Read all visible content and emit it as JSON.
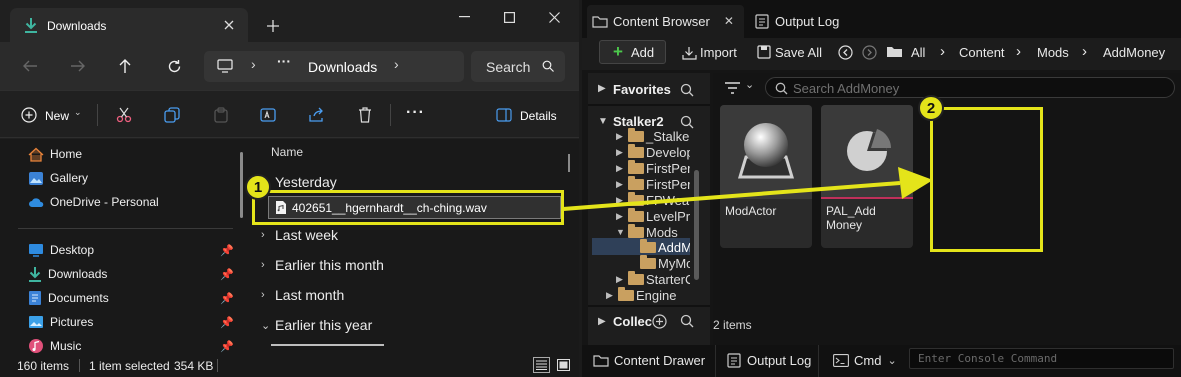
{
  "explorer": {
    "tab_title": "Downloads",
    "address_crumb": "Downloads",
    "search_placeholder": "Search",
    "toolbar": {
      "new_label": "New",
      "details_label": "Details"
    },
    "sidebar": {
      "top": [
        {
          "label": "Home",
          "icon": "home-icon"
        },
        {
          "label": "Gallery",
          "icon": "gallery-icon"
        },
        {
          "label": "OneDrive - Personal",
          "icon": "cloud-icon"
        }
      ],
      "pinned": [
        {
          "label": "Desktop",
          "icon": "desktop-icon"
        },
        {
          "label": "Downloads",
          "icon": "download-icon"
        },
        {
          "label": "Documents",
          "icon": "document-icon"
        },
        {
          "label": "Pictures",
          "icon": "pictures-icon"
        },
        {
          "label": "Music",
          "icon": "music-icon"
        }
      ]
    },
    "column_header": "Name",
    "groups": [
      "Yesterday",
      "Last week",
      "Earlier this month",
      "Last month",
      "Earlier this year"
    ],
    "dragged_file": "402651__hgernhardt__ch-ching.wav",
    "status": {
      "item_count": "160 items",
      "selected": "1 item selected",
      "size": "354 KB"
    }
  },
  "unreal": {
    "tabs": [
      "Content Browser",
      "Output Log"
    ],
    "toolbar": {
      "add": "Add",
      "import": "Import",
      "save_all": "Save All"
    },
    "breadcrumb": [
      "All",
      "Content",
      "Mods",
      "AddMoney"
    ],
    "favorites_label": "Favorites",
    "project_label": "Stalker2",
    "tree": [
      "_Stalke",
      "Develop",
      "FirstPer",
      "FPWea",
      "LevelPr",
      "Mods",
      "AddM",
      "MyMo",
      "StarterC",
      "Engine"
    ],
    "collections_label": "Collec",
    "search_placeholder": "Search AddMoney",
    "assets": [
      {
        "name": "ModActor",
        "bar_color": "#3a3a3a"
      },
      {
        "name": "PAL_Add\nMoney",
        "bar_color": "#c0305a"
      }
    ],
    "item_count": "2 items",
    "bottom": {
      "drawer": "Content Drawer",
      "log": "Output Log",
      "cmd": "Cmd",
      "console_placeholder": "Enter Console Command"
    }
  },
  "overlay": {
    "step_1": "1",
    "step_2": "2",
    "highlight_color": "#e4e41a"
  }
}
